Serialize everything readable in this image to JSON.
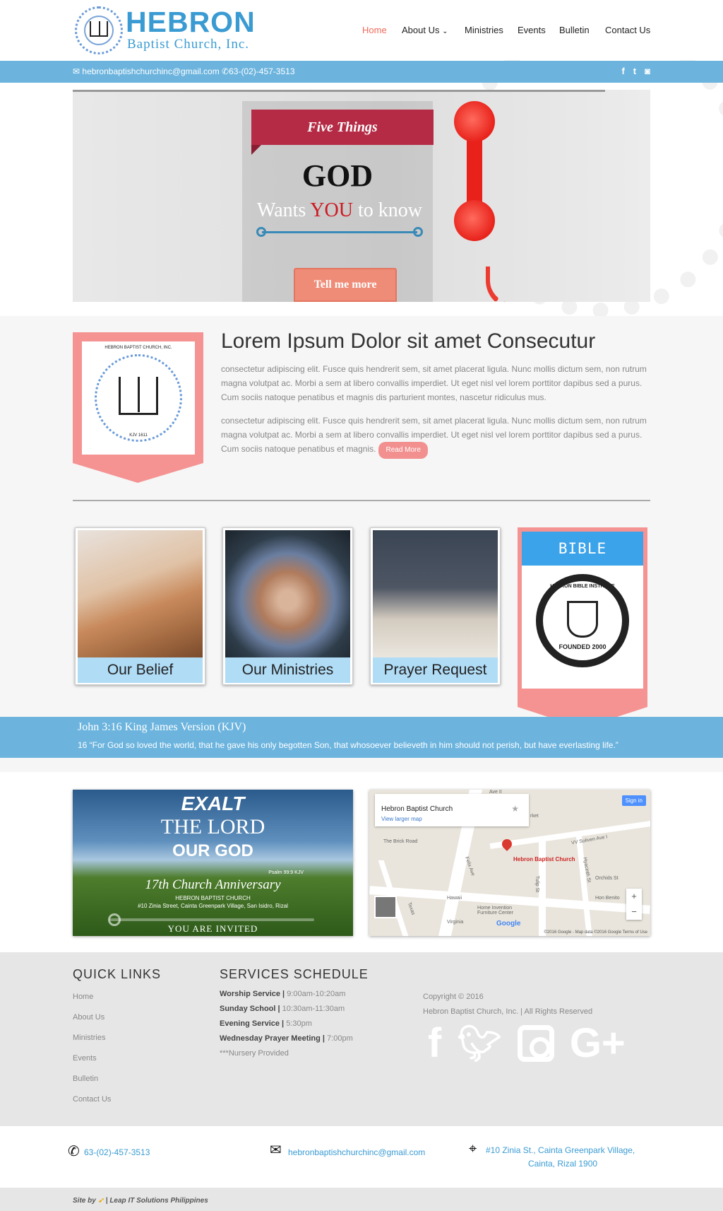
{
  "header": {
    "logo_title": "HEBRON",
    "logo_subtitle": "Baptist Church, Inc.",
    "nav": [
      {
        "label": "Home"
      },
      {
        "label": "About Us"
      },
      {
        "label": "Ministries"
      },
      {
        "label": "Events"
      },
      {
        "label": "Bulletin"
      },
      {
        "label": "Contact Us"
      }
    ],
    "about_caret": "⌄",
    "active_color": "#f06a5a"
  },
  "topbar": {
    "email": "hebronbaptishchurchinc@gmail.com",
    "phone": "63-(02)-457-3513",
    "social_icons": [
      "facebook-icon",
      "twitter-icon",
      "instagram-icon"
    ]
  },
  "slider": {
    "banner": "Five Things",
    "god": "GOD",
    "wants": "Wants",
    "you": "YOU",
    "to_know": "to know",
    "button": "Tell me more"
  },
  "about": {
    "heading": "Lorem Ipsum Dolor sit amet Consecutur",
    "badge_text": "HEBRON BAPTIST CHURCH, INC.",
    "badge_sub": "KJV 1611",
    "paragraph1": "consectetur adipiscing elit. Fusce quis hendrerit sem, sit amet placerat ligula. Nunc mollis dictum sem, non rutrum magna volutpat ac. Morbi a sem at libero convallis imperdiet. Ut eget nisl vel lorem porttitor dapibus sed a purus. Cum sociis natoque penatibus et magnis dis parturient montes, nascetur ridiculus mus.",
    "paragraph2": "consectetur adipiscing elit. Fusce quis hendrerit sem, sit amet placerat ligula. Nunc mollis dictum sem, non rutrum magna volutpat ac. Morbi a sem at libero convallis imperdiet. Ut eget nisl vel lorem porttitor dapibus sed a purus. Cum sociis natoque penatibus et magnis.",
    "read_more": "Read More"
  },
  "cards": [
    {
      "label": "Our Belief"
    },
    {
      "label": "Our Ministries"
    },
    {
      "label": "Prayer Request"
    }
  ],
  "institute": {
    "title": "BIBLE INSTITUTE",
    "seal_top": "HEBRON BIBLE INSTITUTE",
    "seal_bottom": "FOUNDED 2000"
  },
  "verse": {
    "title": "John 3:16 King James Version (KJV)",
    "body": "16 “For God so loved the world, that he gave his only begotten Son, that whosoever believeth in him should not perish, but have everlasting life.”"
  },
  "promo": {
    "exalt": "EXALT",
    "the_lord": "THE LORD",
    "our_god": "OUR GOD",
    "psalm": "Psalm 99:9 KJV",
    "anniversary": "17th Church Anniversary",
    "church": "HEBRON BAPTIST CHURCH",
    "address": "#10 Zinia Street, Cainta Greenpark Village, San Isidro, Rizal",
    "invited": "YOU ARE INVITED"
  },
  "map": {
    "place": "Hebron Baptist Church",
    "larger": "View larger map",
    "sign_in": "Sign in",
    "pin_label": "Hebron Baptist Church",
    "labels": [
      "The Brick Road",
      "Felix Ave",
      "Hawaii",
      "Texas",
      "Virginia",
      "Tulip St",
      "Hyacinth St",
      "Orchids St",
      "Hon Benito",
      "VV Soliven Ave I",
      "Home Invention Furniture Center",
      "rket",
      "Ave II"
    ],
    "footer": "©2016 Google - Map data ©2016 Google    Terms of Use",
    "google": "Google"
  },
  "footer": {
    "quick_links_title": "QUICK LINKS",
    "quick_links": [
      "Home",
      "About Us",
      "Ministries",
      "Events",
      "Bulletin",
      "Contact Us"
    ],
    "schedule_title": "SERVICES SCHEDULE",
    "schedule": [
      {
        "name": "Worship Service",
        "sep": " | ",
        "time": "9:00am-10:20am"
      },
      {
        "name": "Sunday School",
        "sep": " | ",
        "time": "10:30am-11:30am"
      },
      {
        "name": "Evening Service",
        "sep": " | ",
        "time": "5:30pm"
      },
      {
        "name": "Wednesday Prayer Meeting",
        "sep": " | ",
        "time": "7:00pm"
      }
    ],
    "nursery": "***Nursery Provided",
    "copyright": "Copyright © 2016",
    "rights": "Hebron Baptist Church, Inc. | All Rights Reserved",
    "big_social_icons": [
      "facebook-icon",
      "twitter-icon",
      "instagram-icon",
      "google-plus-icon"
    ]
  },
  "contact_bar": {
    "phone": "63-(02)-457-3513",
    "email": "hebronbaptishchurchinc@gmail.com",
    "address_line1": "#10 Zinia St., Cainta Greenpark Village,",
    "address_line2": "Cainta, Rizal 1900"
  },
  "site_by": "Site by",
  "site_by_company": "| Leap IT Solutions Philippines",
  "colors": {
    "brand_blue": "#3a9bd3",
    "bar_blue": "#6cb4de",
    "coral": "#f59393",
    "nav_active": "#f06a5a"
  }
}
